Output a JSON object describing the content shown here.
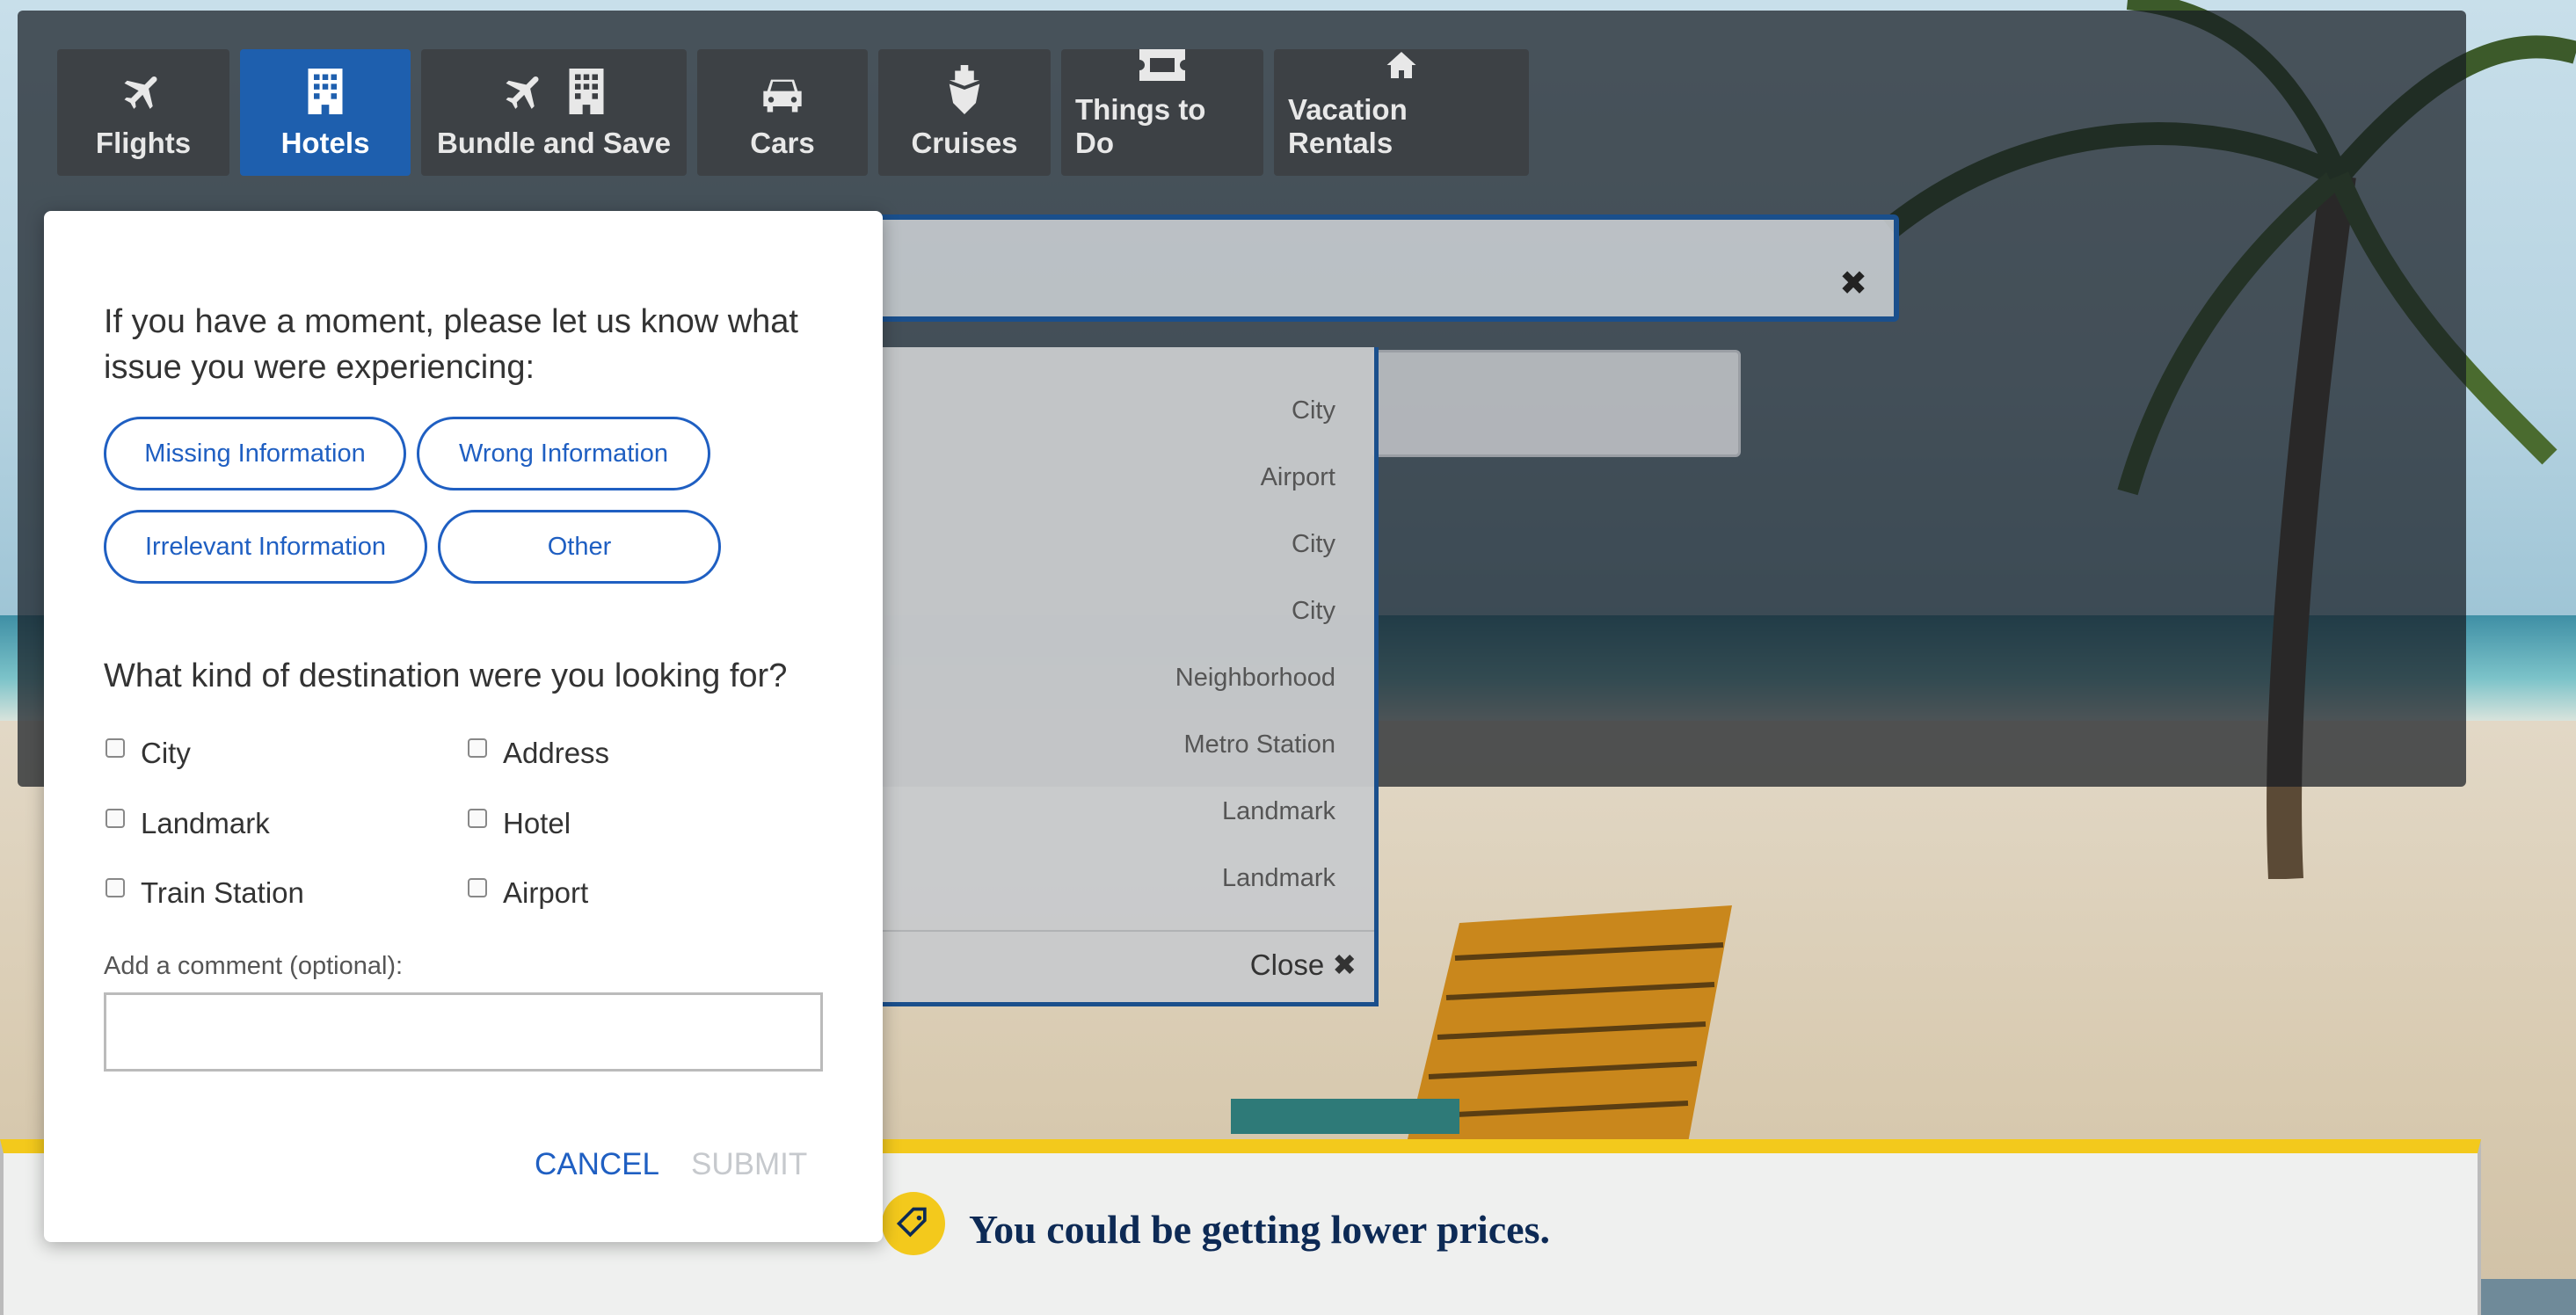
{
  "tabs": [
    {
      "label": "Flights",
      "icon": "plane-icon"
    },
    {
      "label": "Hotels",
      "icon": "building-icon",
      "active": true
    },
    {
      "label": "Bundle and Save",
      "icon": "plane-building-icon"
    },
    {
      "label": "Cars",
      "icon": "car-icon"
    },
    {
      "label": "Cruises",
      "icon": "ship-icon"
    },
    {
      "label": "Things to Do",
      "icon": "ticket-icon"
    },
    {
      "label": "Vacation Rentals",
      "icon": "house-icon"
    }
  ],
  "destination": {
    "clear_icon": "close-icon",
    "clear_symbol": "✖"
  },
  "suggestions": {
    "types": [
      "City",
      "Airport",
      "City",
      "City",
      "Neighborhood",
      "Metro Station",
      "Landmark",
      "Landmark"
    ],
    "close_label": "Close",
    "close_symbol": "✖"
  },
  "feedback_modal": {
    "question1": "If you have a moment, please let us know what issue you were experiencing:",
    "issue_options": [
      "Missing Information",
      "Wrong Information",
      "Irrelevant Information",
      "Other"
    ],
    "question2": "What kind of destination were you looking for?",
    "destination_types": [
      "City",
      "Address",
      "Landmark",
      "Hotel",
      "Train Station",
      "Airport"
    ],
    "comment_label": "Add a comment (optional):",
    "comment_value": "",
    "cancel_label": "CANCEL",
    "submit_label": "SUBMIT"
  },
  "price_banner": {
    "text": "You could be getting lower prices.",
    "icon": "price-tag-icon"
  },
  "colors": {
    "accent_blue": "#1f5fc2",
    "active_tab": "#1e5fae",
    "banner_yellow": "#f3c91c",
    "banner_text": "#0d2a55"
  }
}
